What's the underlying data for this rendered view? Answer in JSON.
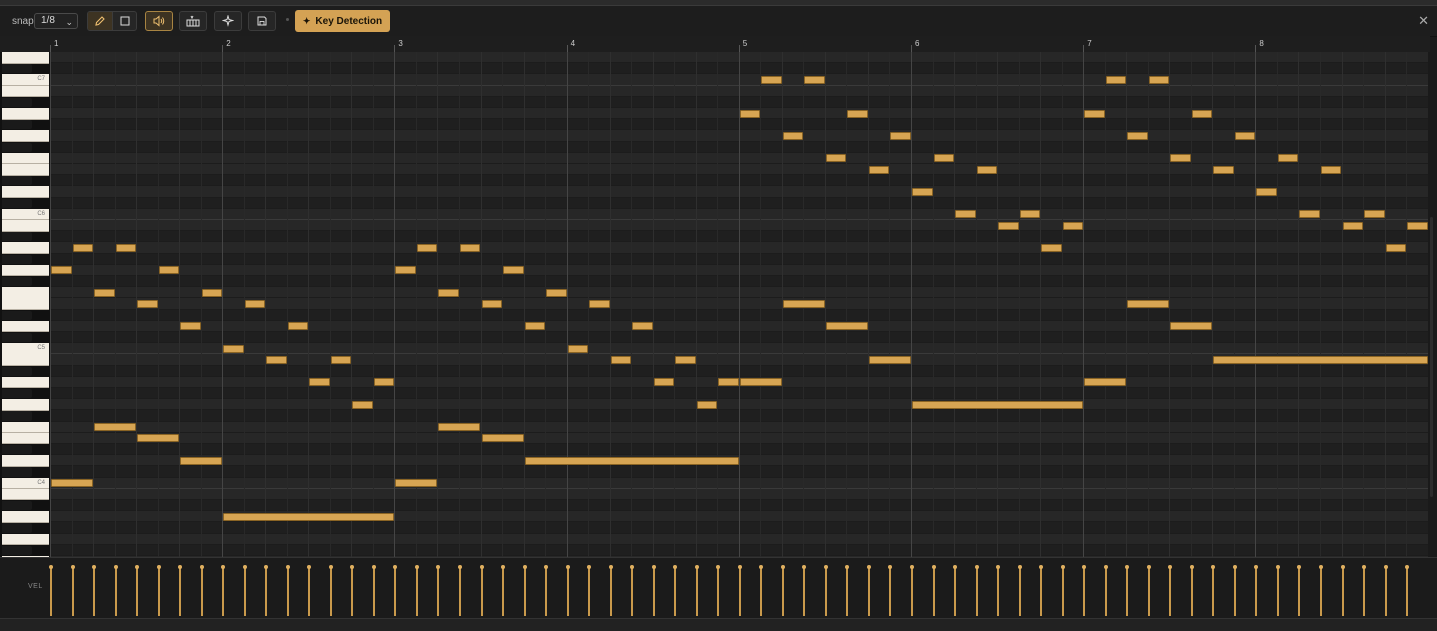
{
  "toolbar": {
    "snap_label": "snap",
    "snap_value": "1/8",
    "tools": [
      "pencil-icon",
      "select-rect-icon",
      "speaker-icon",
      "piano-keys-icon",
      "magic-wand-icon",
      "save-icon"
    ],
    "key_detection_label": "Key Detection",
    "close_icon": "close-icon"
  },
  "ruler": {
    "bars": [
      "1",
      "2",
      "3",
      "4",
      "5",
      "6",
      "7",
      "8"
    ]
  },
  "keyboard": {
    "labels": {
      "C7": "C7",
      "C6": "C6",
      "C5": "C5",
      "C4": "C4"
    }
  },
  "velocity": {
    "label": "VEL",
    "count": 64,
    "level": 0.95
  },
  "notes": [
    {
      "bar": 1.0,
      "len": 0.125,
      "pitch": "G5"
    },
    {
      "bar": 1.125,
      "len": 0.125,
      "pitch": "A5"
    },
    {
      "bar": 1.25,
      "len": 0.125,
      "pitch": "F5"
    },
    {
      "bar": 1.375,
      "len": 0.125,
      "pitch": "A5"
    },
    {
      "bar": 1.5,
      "len": 0.125,
      "pitch": "E5"
    },
    {
      "bar": 1.625,
      "len": 0.125,
      "pitch": "G5"
    },
    {
      "bar": 1.75,
      "len": 0.125,
      "pitch": "D5"
    },
    {
      "bar": 1.875,
      "len": 0.125,
      "pitch": "F5"
    },
    {
      "bar": 2.0,
      "len": 0.125,
      "pitch": "C5"
    },
    {
      "bar": 2.125,
      "len": 0.125,
      "pitch": "E5"
    },
    {
      "bar": 2.25,
      "len": 0.125,
      "pitch": "B4"
    },
    {
      "bar": 2.375,
      "len": 0.125,
      "pitch": "D5"
    },
    {
      "bar": 2.5,
      "len": 0.125,
      "pitch": "A4"
    },
    {
      "bar": 2.625,
      "len": 0.125,
      "pitch": "B4"
    },
    {
      "bar": 2.75,
      "len": 0.125,
      "pitch": "G4"
    },
    {
      "bar": 2.875,
      "len": 0.125,
      "pitch": "A4"
    },
    {
      "bar": 1.0,
      "len": 0.25,
      "pitch": "C4"
    },
    {
      "bar": 1.25,
      "len": 0.25,
      "pitch": "F4"
    },
    {
      "bar": 1.5,
      "len": 0.25,
      "pitch": "E4"
    },
    {
      "bar": 1.75,
      "len": 0.25,
      "pitch": "D4"
    },
    {
      "bar": 2.0,
      "len": 1.0,
      "pitch": "A3"
    },
    {
      "bar": 3.0,
      "len": 0.125,
      "pitch": "G5"
    },
    {
      "bar": 3.125,
      "len": 0.125,
      "pitch": "A5"
    },
    {
      "bar": 3.25,
      "len": 0.125,
      "pitch": "F5"
    },
    {
      "bar": 3.375,
      "len": 0.125,
      "pitch": "A5"
    },
    {
      "bar": 3.5,
      "len": 0.125,
      "pitch": "E5"
    },
    {
      "bar": 3.625,
      "len": 0.125,
      "pitch": "G5"
    },
    {
      "bar": 3.75,
      "len": 0.125,
      "pitch": "D5"
    },
    {
      "bar": 3.875,
      "len": 0.125,
      "pitch": "F5"
    },
    {
      "bar": 4.0,
      "len": 0.125,
      "pitch": "C5"
    },
    {
      "bar": 4.125,
      "len": 0.125,
      "pitch": "E5"
    },
    {
      "bar": 4.25,
      "len": 0.125,
      "pitch": "B4"
    },
    {
      "bar": 4.375,
      "len": 0.125,
      "pitch": "D5"
    },
    {
      "bar": 4.5,
      "len": 0.125,
      "pitch": "A4"
    },
    {
      "bar": 4.625,
      "len": 0.125,
      "pitch": "B4"
    },
    {
      "bar": 4.75,
      "len": 0.125,
      "pitch": "G4"
    },
    {
      "bar": 4.875,
      "len": 0.125,
      "pitch": "A4"
    },
    {
      "bar": 3.0,
      "len": 0.25,
      "pitch": "C4"
    },
    {
      "bar": 3.25,
      "len": 0.25,
      "pitch": "F4"
    },
    {
      "bar": 3.5,
      "len": 0.25,
      "pitch": "E4"
    },
    {
      "bar": 3.75,
      "len": 1.25,
      "pitch": "D4"
    },
    {
      "bar": 5.0,
      "len": 0.125,
      "pitch": "A6"
    },
    {
      "bar": 5.125,
      "len": 0.125,
      "pitch": "C7"
    },
    {
      "bar": 5.25,
      "len": 0.125,
      "pitch": "G6"
    },
    {
      "bar": 5.375,
      "len": 0.125,
      "pitch": "C7"
    },
    {
      "bar": 5.5,
      "len": 0.125,
      "pitch": "F6"
    },
    {
      "bar": 5.625,
      "len": 0.125,
      "pitch": "A6"
    },
    {
      "bar": 5.75,
      "len": 0.125,
      "pitch": "E6"
    },
    {
      "bar": 5.875,
      "len": 0.125,
      "pitch": "G6"
    },
    {
      "bar": 6.0,
      "len": 0.125,
      "pitch": "D6"
    },
    {
      "bar": 6.125,
      "len": 0.125,
      "pitch": "F6"
    },
    {
      "bar": 6.25,
      "len": 0.125,
      "pitch": "C6"
    },
    {
      "bar": 6.375,
      "len": 0.125,
      "pitch": "E6"
    },
    {
      "bar": 6.5,
      "len": 0.125,
      "pitch": "B5"
    },
    {
      "bar": 6.625,
      "len": 0.125,
      "pitch": "C6"
    },
    {
      "bar": 6.75,
      "len": 0.125,
      "pitch": "A5"
    },
    {
      "bar": 6.875,
      "len": 0.125,
      "pitch": "B5"
    },
    {
      "bar": 5.0,
      "len": 0.25,
      "pitch": "A4"
    },
    {
      "bar": 5.25,
      "len": 0.25,
      "pitch": "E5"
    },
    {
      "bar": 5.5,
      "len": 0.25,
      "pitch": "D5"
    },
    {
      "bar": 5.75,
      "len": 0.25,
      "pitch": "B4"
    },
    {
      "bar": 6.0,
      "len": 1.0,
      "pitch": "G4"
    },
    {
      "bar": 4.875,
      "len": 0.125,
      "pitch": "A4"
    },
    {
      "bar": 7.0,
      "len": 0.125,
      "pitch": "A6"
    },
    {
      "bar": 7.125,
      "len": 0.125,
      "pitch": "C7"
    },
    {
      "bar": 7.25,
      "len": 0.125,
      "pitch": "G6"
    },
    {
      "bar": 7.375,
      "len": 0.125,
      "pitch": "C7"
    },
    {
      "bar": 7.5,
      "len": 0.125,
      "pitch": "F6"
    },
    {
      "bar": 7.625,
      "len": 0.125,
      "pitch": "A6"
    },
    {
      "bar": 7.75,
      "len": 0.125,
      "pitch": "E6"
    },
    {
      "bar": 7.875,
      "len": 0.125,
      "pitch": "G6"
    },
    {
      "bar": 8.0,
      "len": 0.125,
      "pitch": "D6"
    },
    {
      "bar": 8.125,
      "len": 0.125,
      "pitch": "F6"
    },
    {
      "bar": 8.25,
      "len": 0.125,
      "pitch": "C6"
    },
    {
      "bar": 8.375,
      "len": 0.125,
      "pitch": "E6"
    },
    {
      "bar": 8.5,
      "len": 0.125,
      "pitch": "B5"
    },
    {
      "bar": 8.625,
      "len": 0.125,
      "pitch": "C6"
    },
    {
      "bar": 8.75,
      "len": 0.125,
      "pitch": "A5"
    },
    {
      "bar": 8.875,
      "len": 0.125,
      "pitch": "B5"
    },
    {
      "bar": 7.0,
      "len": 0.25,
      "pitch": "A4"
    },
    {
      "bar": 7.25,
      "len": 0.25,
      "pitch": "E5"
    },
    {
      "bar": 7.5,
      "len": 0.25,
      "pitch": "D5"
    },
    {
      "bar": 7.75,
      "len": 1.25,
      "pitch": "B4"
    }
  ],
  "colors": {
    "note": "#d7a553",
    "accent": "#d4a254",
    "grid_bg": "#262626"
  }
}
